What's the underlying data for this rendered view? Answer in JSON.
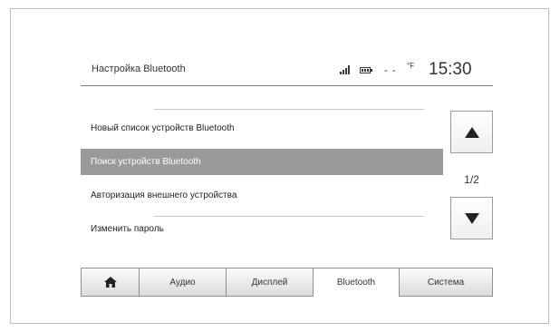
{
  "header": {
    "title": "Настройка Bluetooth",
    "signal_icon": "signal-strength-icon",
    "battery_icon": "battery-icon",
    "temperature": "- -",
    "temperature_unit": "°F",
    "clock": "15:30"
  },
  "list": {
    "items": [
      {
        "label": "Новый список устройств Bluetooth",
        "selected": false
      },
      {
        "label": "Поиск устройств Bluetooth",
        "selected": true
      },
      {
        "label": "Авторизация внешнего устройства",
        "selected": false
      },
      {
        "label": "Изменить пароль",
        "selected": false
      }
    ]
  },
  "pagination": {
    "page": "1/2",
    "up_icon": "triangle-up-icon",
    "down_icon": "triangle-down-icon"
  },
  "tabs": [
    {
      "label": "",
      "icon": "home-icon",
      "active": false
    },
    {
      "label": "Аудио",
      "active": false
    },
    {
      "label": "Дисплей",
      "active": false
    },
    {
      "label": "Bluetooth",
      "active": true
    },
    {
      "label": "Система",
      "active": false
    }
  ],
  "colors": {
    "selected_row": "#9a9a9a",
    "text": "#333333",
    "border": "#8f8f8f"
  }
}
